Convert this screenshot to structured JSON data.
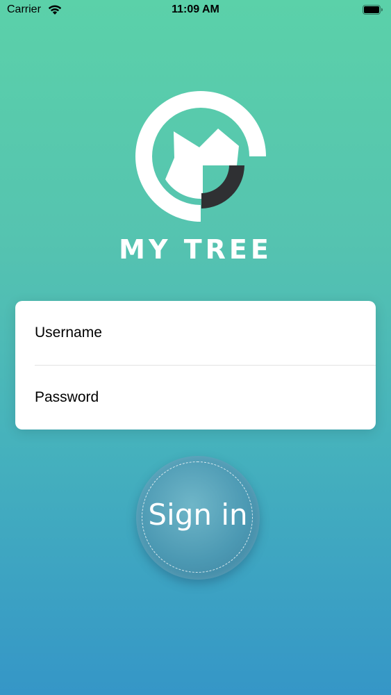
{
  "status_bar": {
    "carrier": "Carrier",
    "time": "11:09 AM",
    "wifi_icon": "wifi-icon",
    "battery_icon": "battery-icon"
  },
  "app": {
    "logo_icon": "my-tree-logo",
    "title": "MY TREE"
  },
  "login_form": {
    "username_placeholder": "Username",
    "password_placeholder": "Password"
  },
  "sign_in_button": {
    "label": "Sign in"
  },
  "colors": {
    "background_top": "#5bd1a9",
    "background_bottom": "#3596c7",
    "card": "#ffffff",
    "logo_dark": "#2f3033"
  }
}
